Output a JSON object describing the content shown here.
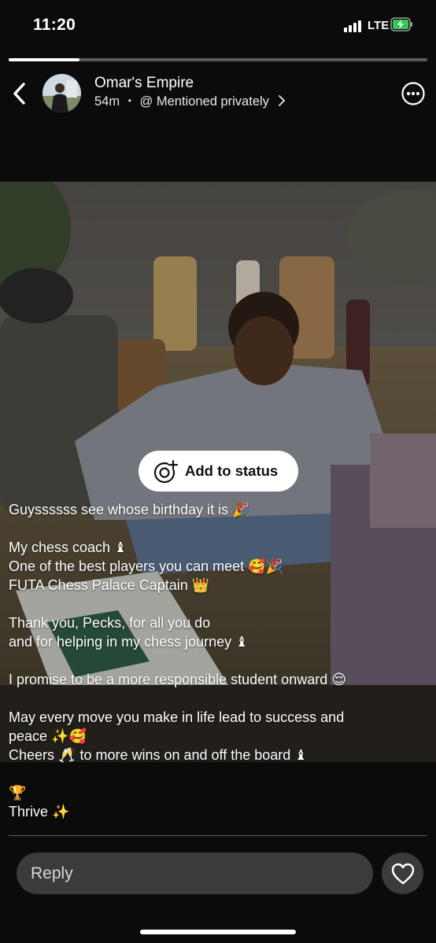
{
  "status_bar": {
    "time": "11:20",
    "network": "LTE"
  },
  "story": {
    "progress": 0.17
  },
  "header": {
    "name": "Omar's Empire",
    "age": "54m",
    "separator": "•",
    "visibility": "@ Mentioned privately"
  },
  "add_to_status": {
    "label": "Add to status"
  },
  "caption": {
    "lines": [
      "Guyssssss see whose birthday it is 🎉",
      "",
      "My chess coach ♝",
      "One of the best players you can meet 🥰🎉",
      "FUTA Chess Palace Captain 👑",
      "",
      "Thank you, Pecks, for all you do",
      "and for helping in my chess journey ♝",
      "",
      "I promise to be a more responsible student onward 😌",
      "",
      "May every move you make in life lead to success and",
      "peace ✨🥰",
      "Cheers 🥂 to more wins on and off the board ♝",
      "",
      "🏆",
      "Thrive ✨"
    ]
  },
  "reply": {
    "placeholder": "Reply"
  },
  "icons": {
    "back": "chevron-left-icon",
    "menu": "more-icon",
    "add_status": "camera-plus-icon",
    "like": "heart-icon"
  }
}
